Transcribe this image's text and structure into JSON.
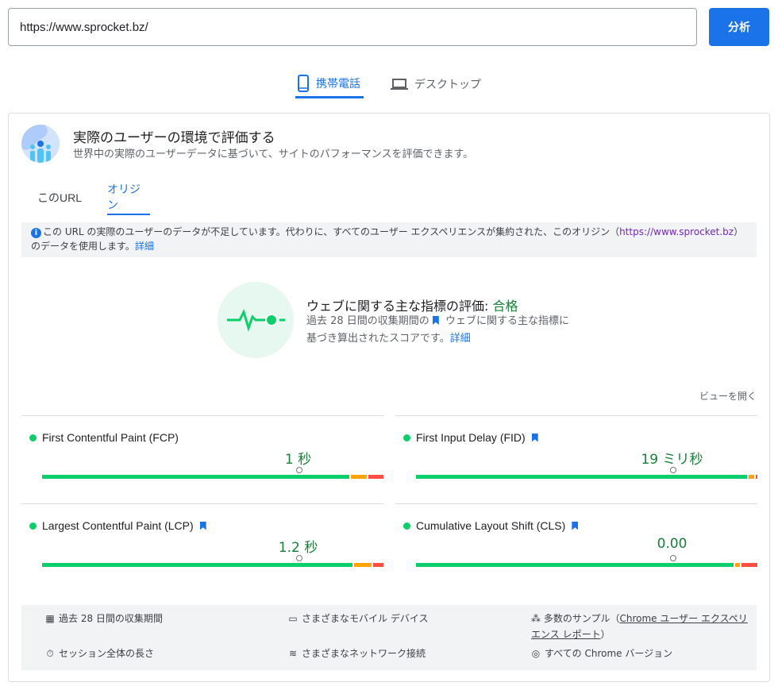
{
  "search": {
    "url": "https://www.sprocket.bz/",
    "analyze_label": "分析"
  },
  "device_tabs": [
    {
      "label": "携帯電話",
      "icon": "smartphone-icon",
      "active": true
    },
    {
      "label": "デスクトップ",
      "icon": "laptop-icon",
      "active": false
    }
  ],
  "field_data": {
    "title": "実際のユーザーの環境で評価する",
    "subtitle": "世界中の実際のユーザーデータに基づいて、サイトのパフォーマンスを評価できます。",
    "tabs": [
      {
        "label": "このURL",
        "active": false
      },
      {
        "label": "オリジン",
        "active": true
      }
    ],
    "notice": {
      "text": "この URL の実際のユーザーのデータが不足しています。代わりに、すべてのユーザー エクスペリエンスが集約された、このオリジン（",
      "origin": "https://www.sprocket.bz",
      "text_after": "）のデータを使用します。",
      "link": "詳細"
    },
    "assessment": {
      "title": "ウェブに関する主な指標の評価:",
      "result": "合格",
      "desc_before": "過去 28 日間の収集期間の",
      "desc_after": "ウェブに関する主な指標に基づき算出されたスコアです。",
      "link": "詳細"
    },
    "expand_label": "ビューを開く",
    "metrics": [
      {
        "name": "First Contentful Paint (FCP)",
        "value": "1 秒",
        "core": false,
        "dist": [
          0.9,
          0.05,
          0.05
        ],
        "marker": 0.75
      },
      {
        "name": "First Input Delay (FID)",
        "value": "19 ミリ秒",
        "core": true,
        "dist": [
          0.97,
          0.02,
          0.01
        ],
        "marker": 0.75
      },
      {
        "name": "Largest Contentful Paint (LCP)",
        "value": "1.2 秒",
        "core": true,
        "dist": [
          0.91,
          0.055,
          0.035
        ],
        "marker": 0.75
      },
      {
        "name": "Cumulative Layout Shift (CLS)",
        "value": "0.00",
        "core": true,
        "dist": [
          0.93,
          0.02,
          0.05
        ],
        "marker": 0.75
      }
    ],
    "footer": {
      "period": "過去 28 日間の収集期間",
      "devices": "さまざまなモバイル デバイス",
      "samples_before": "多数のサンプル（",
      "samples_link": "Chrome ユーザー エクスペリエンス レポート",
      "samples_after": "）",
      "session": "セッション全体の長さ",
      "network": "さまざまなネットワーク接続",
      "chrome": "すべての Chrome バージョン"
    }
  },
  "colors": {
    "good": "#0cce6b",
    "average": "#ffa400",
    "poor": "#ff4e42",
    "accent": "#1a73e8"
  }
}
